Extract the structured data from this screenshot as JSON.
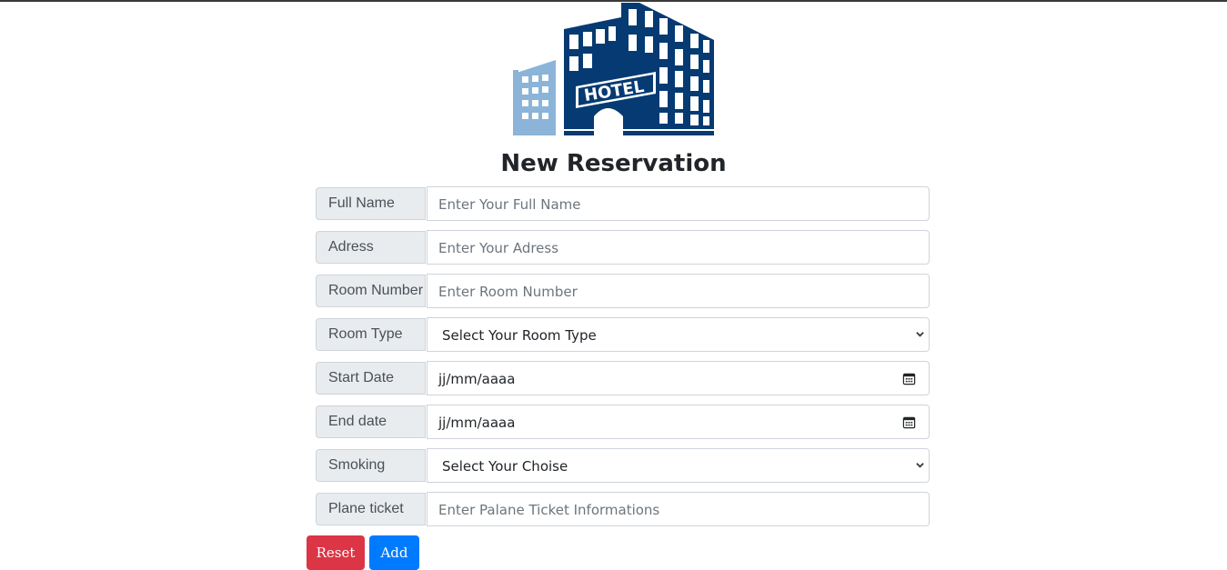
{
  "logo": {
    "text": "HOTEL"
  },
  "form": {
    "title": "New Reservation",
    "rows": [
      {
        "label": "Full Name",
        "placeholder": "Enter Your Full Name"
      },
      {
        "label": "Adress",
        "placeholder": "Enter Your Adress"
      },
      {
        "label": "Room Number",
        "placeholder": "Enter Room Number"
      },
      {
        "label": "Room Type",
        "selected": "Select Your Room Type"
      },
      {
        "label": "Start Date",
        "value": "jj/mm/aaaa"
      },
      {
        "label": "End date",
        "value": "jj/mm/aaaa"
      },
      {
        "label": "Smoking",
        "selected": "Select Your Choise"
      },
      {
        "label": "Plane ticket",
        "placeholder": "Enter Palane Ticket Informations"
      }
    ],
    "reset_label": "Reset",
    "add_label": "Add"
  },
  "colors": {
    "brand_navy": "#063a72",
    "brand_light": "#8bb4d8",
    "reset": "#dc3545",
    "add": "#007bff",
    "label_bg": "#e9ecef"
  },
  "icons": {
    "select_arrow": "chevron-down-icon",
    "date_picker": "calendar-icon"
  }
}
